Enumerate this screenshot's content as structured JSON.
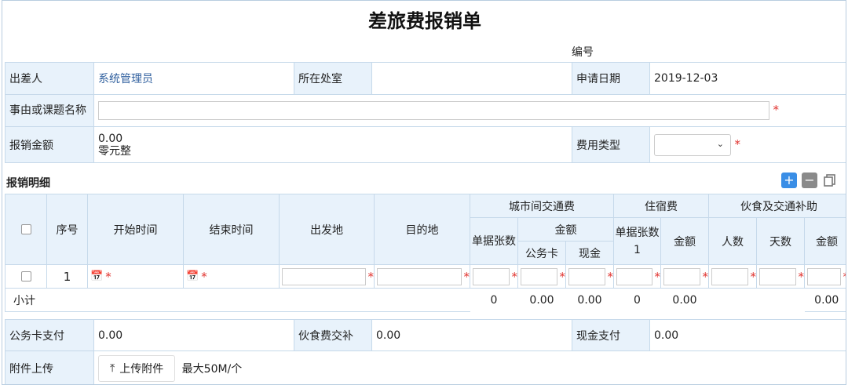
{
  "title": "差旅费报销单",
  "serial_label": "编号",
  "form": {
    "traveler_label": "出差人",
    "traveler_value": "系统管理员",
    "dept_label": "所在处室",
    "apply_date_label": "申请日期",
    "apply_date_value": "2019-12-03",
    "reason_label": "事由或课题名称",
    "amount_label": "报销金额",
    "amount_value": "0.00",
    "amount_words": "零元整",
    "fee_type_label": "费用类型",
    "required_mark": "*"
  },
  "details": {
    "title": "报销明细",
    "headers": {
      "seq": "序号",
      "start": "开始时间",
      "end": "结束时间",
      "from": "出发地",
      "to": "目的地",
      "transport": "城市间交通费",
      "voucher_count": "单据张数",
      "amount": "金额",
      "card": "公务卡",
      "cash": "现金",
      "lodging": "住宿费",
      "voucher_count1": "单据张数1",
      "lodging_amount": "金额",
      "meal": "伙食及交通补助",
      "persons": "人数",
      "days": "天数",
      "meal_amount": "金额"
    },
    "rows": [
      {
        "seq": "1"
      }
    ],
    "subtotal": {
      "label": "小计",
      "voucher_count": "0",
      "card": "0.00",
      "cash": "0.00",
      "voucher_count1": "0",
      "lodging_amount": "0.00",
      "meal_amount": "0.00"
    }
  },
  "summary": {
    "card_pay_label": "公务卡支付",
    "card_pay_value": "0.00",
    "meal_label": "伙食费交补",
    "meal_value": "0.00",
    "cash_pay_label": "现金支付",
    "cash_pay_value": "0.00",
    "attach_label": "附件上传",
    "upload_button": "上传附件",
    "upload_hint": "最大50M/个"
  },
  "icons": {
    "add": "plus-icon",
    "remove": "minus-icon",
    "copy": "copy-icon",
    "calendar": "calendar-icon",
    "upload": "upload-icon",
    "dropdown": "chevron-down-icon"
  },
  "colors": {
    "label_bg": "#e8f2fb",
    "border": "#c6d9ea",
    "link": "#2f5f9e",
    "required": "#e0312d",
    "accent": "#3a8ee6"
  }
}
